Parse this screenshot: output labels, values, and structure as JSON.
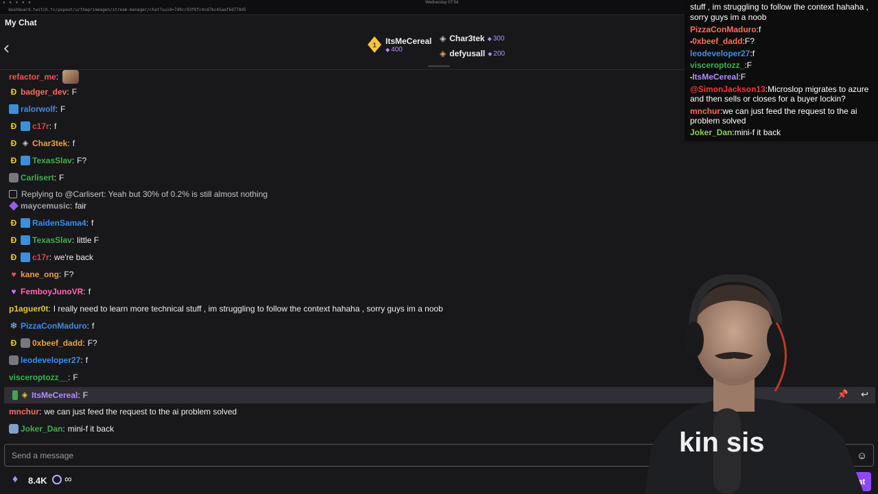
{
  "browser": {
    "url": "dashboard.twitch.tv/popout/u/theprimeagen/stream-manager/chat?uuid=7d9cc93f0fc4cd7bc45aaf6d778d5",
    "clock": "Wednesday 07:54"
  },
  "header": {
    "title": "My Chat",
    "leaderboard": [
      {
        "name": "ItsMeCereal",
        "points": "400",
        "rank": "1"
      },
      {
        "name": "Char3tek",
        "points": "300"
      },
      {
        "name": "defyusall",
        "points": "200"
      }
    ]
  },
  "messages": [
    {
      "user": "refactor_me",
      "color": "#ff4f4f",
      "text": "",
      "badges": [
        "emote"
      ]
    },
    {
      "user": "badger_dev",
      "color": "#ff6b5c",
      "text": "F",
      "badges": [
        "pred"
      ]
    },
    {
      "user": "ralorwolf",
      "color": "#3a8eea",
      "text": "F",
      "badges": [
        "crown"
      ]
    },
    {
      "user": "c17r",
      "color": "#e84040",
      "text": "f",
      "badges": [
        "pred",
        "crown"
      ]
    },
    {
      "user": "Char3tek",
      "color": "#e8a23c",
      "text": "f",
      "badges": [
        "pred",
        "gem"
      ]
    },
    {
      "user": "TexasSlav",
      "color": "#3db04b",
      "text": "F?",
      "badges": [
        "pred",
        "crown"
      ]
    },
    {
      "user": "Carlisert",
      "color": "#3db04b",
      "text": "F",
      "badges": [
        "gray"
      ]
    },
    {
      "reply_to": "Replying to @Carlisert: Yeah but 30% of 0.2% is still almost nothing"
    },
    {
      "user": "maycemusic",
      "color": "#a3a3a3",
      "text": "fair",
      "badges": [
        "purple"
      ]
    },
    {
      "user": "RaidenSama4",
      "color": "#3a8eea",
      "text": "f",
      "badges": [
        "pred",
        "crown"
      ]
    },
    {
      "user": "TexasSlav",
      "color": "#3db04b",
      "text": "little F",
      "badges": [
        "pred",
        "crown"
      ]
    },
    {
      "user": "c17r",
      "color": "#e84040",
      "text": "we're back",
      "badges": [
        "pred",
        "crown"
      ]
    },
    {
      "user": "kane_ong",
      "color": "#e8a23c",
      "text": "F?",
      "badges": [
        "heart"
      ]
    },
    {
      "user": "FemboyJunoVR",
      "color": "#ff69b4",
      "text": "f",
      "badges": [
        "heart2"
      ]
    },
    {
      "user": "p1aguer0t",
      "color": "#e8c53c",
      "text": "I really need to learn more technical stuff , im struggling to follow the context hahaha , sorry guys im a noob",
      "badges": []
    },
    {
      "user": "PizzaConMaduro",
      "color": "#3a8eea",
      "text": "f",
      "badges": [
        "snow"
      ]
    },
    {
      "user": "0xbeef_dadd",
      "color": "#e8a23c",
      "text": "F?",
      "badges": [
        "pred",
        "gray"
      ]
    },
    {
      "user": "leodeveloper27",
      "color": "#3a8eea",
      "text": "f",
      "badges": [
        "gray"
      ]
    },
    {
      "user": "visceroptozz__",
      "color": "#3db04b",
      "text": "F",
      "badges": []
    },
    {
      "user": "ItsMeCereal",
      "color": "#b48bff",
      "text": "F",
      "badges": [
        "green",
        "gem"
      ]
    },
    {
      "user": "mnchur",
      "color": "#ff6b5c",
      "text": "we can just feed the request to the ai problem solved",
      "badges": []
    },
    {
      "user": "Joker_Dan",
      "color": "#3db04b",
      "text": "mini-f it back",
      "badges": [
        "gray"
      ]
    }
  ],
  "input": {
    "placeholder": "Send a message"
  },
  "footer": {
    "points": "8.4K",
    "infinity": "∞",
    "chat_button": "Chat"
  },
  "overlay": {
    "lines": [
      {
        "user": "",
        "text": "stuff , im struggling to follow the context hahaha ,"
      },
      {
        "user": "",
        "text": "sorry guys im a noob"
      },
      {
        "user": "PizzaConMaduro",
        "color": "#ff6b5c",
        "text": "f"
      },
      {
        "user": "0xbeef_dadd",
        "color": "#ff6b5c",
        "text": "F?"
      },
      {
        "user": "leodeveloper27",
        "color": "#3a8eea",
        "text": "f"
      },
      {
        "user": "visceroptozz_",
        "color": "#3db04b",
        "text": "F"
      },
      {
        "user": "ItsMeCereal",
        "color": "#b48bff",
        "text": "F"
      },
      {
        "user": "@SimonJackson13",
        "color": "#ff3333",
        "text": "Microslop migrates to azure"
      },
      {
        "user": "",
        "text": "and then sells or closes for a buyer lockin?"
      },
      {
        "user": "mnchur",
        "color": "#ff6b5c",
        "text": "we can just feed the request to the ai"
      },
      {
        "user": "",
        "text": "problem solved"
      },
      {
        "user": "Joker_Dan",
        "color": "#8bd14b",
        "text": "mini-f it back"
      }
    ]
  },
  "webcam": {
    "shirt_text": "kin  sis"
  }
}
